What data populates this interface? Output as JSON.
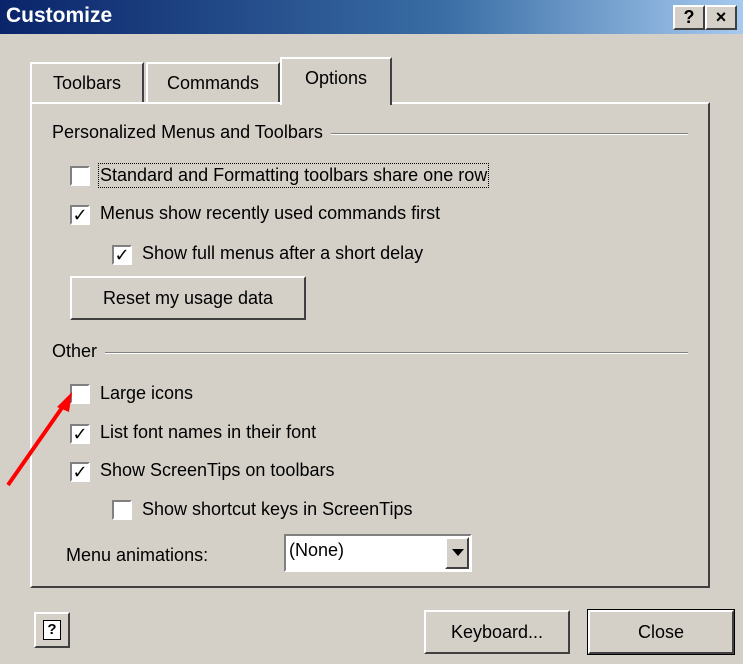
{
  "window": {
    "title": "Customize",
    "help_glyph": "?",
    "close_glyph": "×"
  },
  "tabs": [
    {
      "label": "Toolbars",
      "active": false
    },
    {
      "label": "Commands",
      "active": false
    },
    {
      "label": "Options",
      "active": true
    }
  ],
  "personalized": {
    "group_label": "Personalized Menus and Toolbars",
    "share_row": {
      "label": "Standard and Formatting toolbars share one row",
      "checked": false
    },
    "recent_first": {
      "label": "Menus show recently used commands first",
      "checked": true
    },
    "full_menus_delay": {
      "label": "Show full menus after a short delay",
      "checked": true
    },
    "reset_button": "Reset my usage data"
  },
  "other": {
    "group_label": "Other",
    "large_icons": {
      "label": "Large icons",
      "checked": false
    },
    "font_names": {
      "label": "List font names in their font",
      "checked": true
    },
    "screentips": {
      "label": "Show ScreenTips on toolbars",
      "checked": true
    },
    "shortcut_keys": {
      "label": "Show shortcut keys in ScreenTips",
      "checked": false
    },
    "menu_animations_label": "Menu animations:",
    "menu_animations_value": "(None)"
  },
  "footer": {
    "help_icon_glyph": "?",
    "keyboard_button": "Keyboard...",
    "close_button": "Close"
  },
  "annotation": {
    "arrow_color": "#ff0000"
  },
  "colors": {
    "dialog_bg": "#d4d0c8",
    "title_gradient_start": "#0a246a",
    "title_gradient_end": "#a6caf0"
  }
}
